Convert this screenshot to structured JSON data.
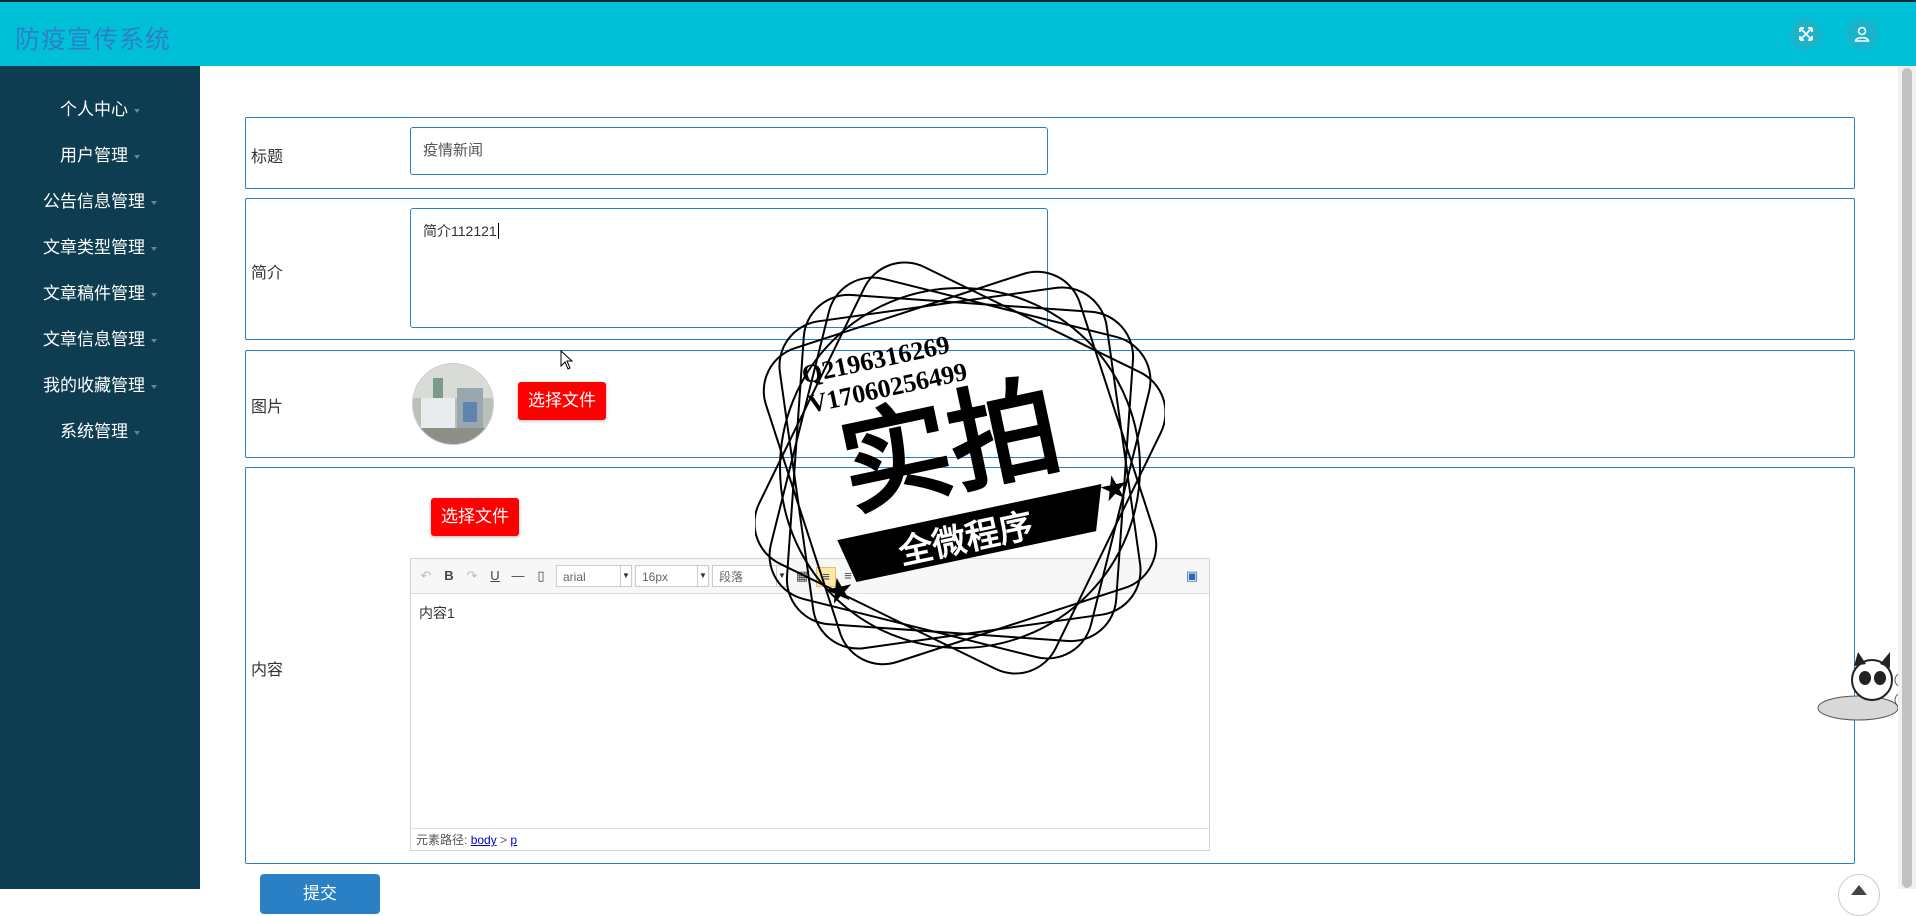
{
  "header": {
    "title": "防疫宣传系统"
  },
  "sidebar": {
    "items": [
      {
        "label": "个人中心"
      },
      {
        "label": "用户管理"
      },
      {
        "label": "公告信息管理"
      },
      {
        "label": "文章类型管理"
      },
      {
        "label": "文章稿件管理"
      },
      {
        "label": "文章信息管理"
      },
      {
        "label": "我的收藏管理"
      },
      {
        "label": "系统管理"
      }
    ]
  },
  "form": {
    "title_label": "标题",
    "title_value": "疫情新闻",
    "summary_label": "简介",
    "summary_value": "简介112121",
    "image_label": "图片",
    "image_upload_label": "选择文件",
    "content_label": "内容",
    "content_upload_label": "选择文件",
    "submit_label": "提交"
  },
  "editor": {
    "font_family": "arial",
    "font_size": "16px",
    "paragraph": "段落",
    "body_text": "内容1",
    "path_label": "元素路径:",
    "path_body": "body",
    "path_sep": ">",
    "path_p": "p"
  },
  "watermark": {
    "line1": "Q2196316269",
    "line2": "V17060256499",
    "main": "实拍",
    "banner": "全微程序"
  }
}
